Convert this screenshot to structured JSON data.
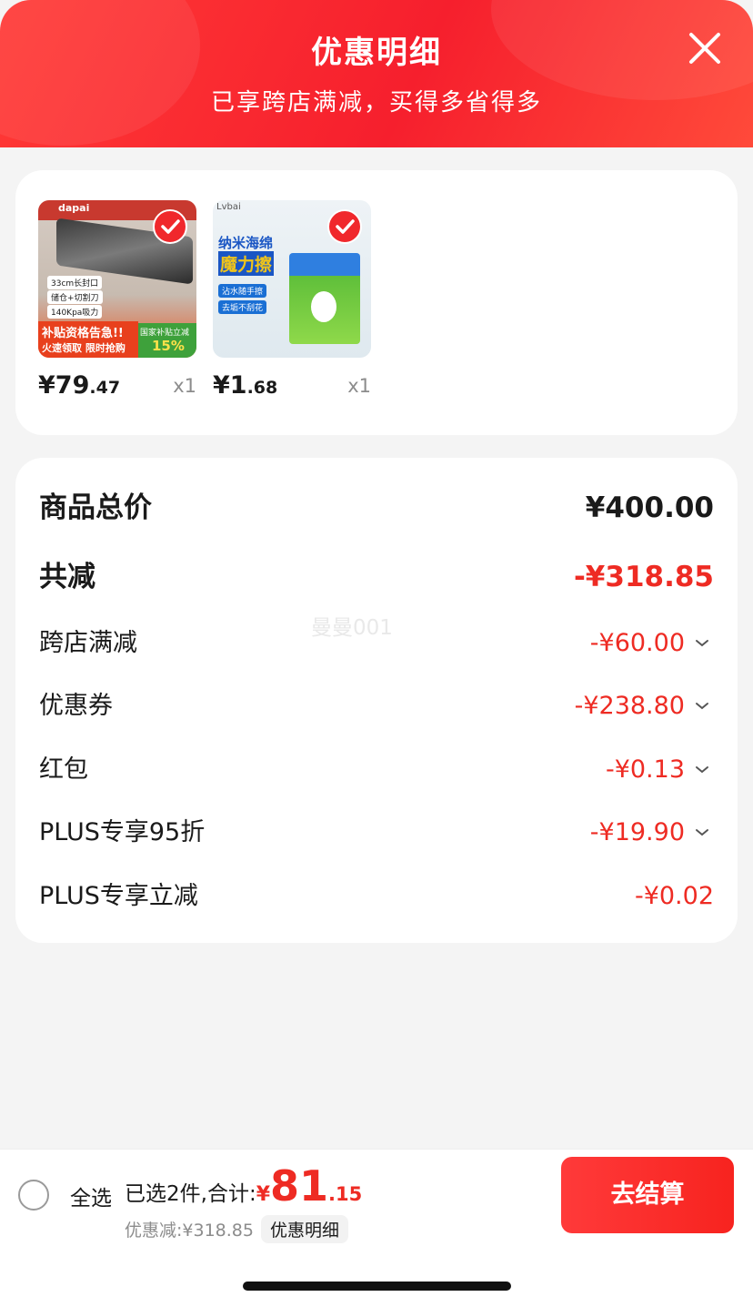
{
  "header": {
    "title": "优惠明细",
    "subtitle": "已享跨店满减，买得多省得多",
    "close_icon": "close-icon"
  },
  "products": [
    {
      "price_int": "¥79",
      "price_dec": ".47",
      "qty": "x1",
      "image_texts": [
        "dapai",
        "33cm长封口",
        "储仓+切割刀",
        "140Kpa吸力",
        "补贴资格告急!!",
        "火速领取 限时抢购",
        "国家补贴立减",
        "15%"
      ]
    },
    {
      "price_int": "¥1",
      "price_dec": ".68",
      "qty": "x1",
      "image_texts": [
        "Lvbai",
        "纳米海绵",
        "魔力擦",
        "沾水随手擦",
        "去垢不刮花"
      ]
    }
  ],
  "summary": {
    "total_label": "商品总价",
    "total_value": "¥400.00",
    "reduce_label": "共减",
    "reduce_value": "-¥318.85",
    "items": [
      {
        "label": "跨店满减",
        "value": "-¥60.00",
        "expandable": true
      },
      {
        "label": "优惠券",
        "value": "-¥238.80",
        "expandable": true
      },
      {
        "label": "红包",
        "value": "-¥0.13",
        "expandable": true
      },
      {
        "label": "PLUS专享95折",
        "value": "-¥19.90",
        "expandable": true
      },
      {
        "label": "PLUS专享立减",
        "value": "-¥0.02",
        "expandable": false
      }
    ]
  },
  "watermark": "曼曼001",
  "footer": {
    "select_all": "全选",
    "selected_text": "已选2件,合计:",
    "currency": "¥",
    "total_int": "81",
    "total_dec": ".15",
    "discount_text": "优惠减:¥318.85",
    "detail_button": "优惠明细",
    "checkout_button": "去结算"
  },
  "colors": {
    "accent": "#f0282c",
    "discount_red": "#ee2b23",
    "text": "#1a1a1a",
    "muted": "#8c8c8c"
  }
}
